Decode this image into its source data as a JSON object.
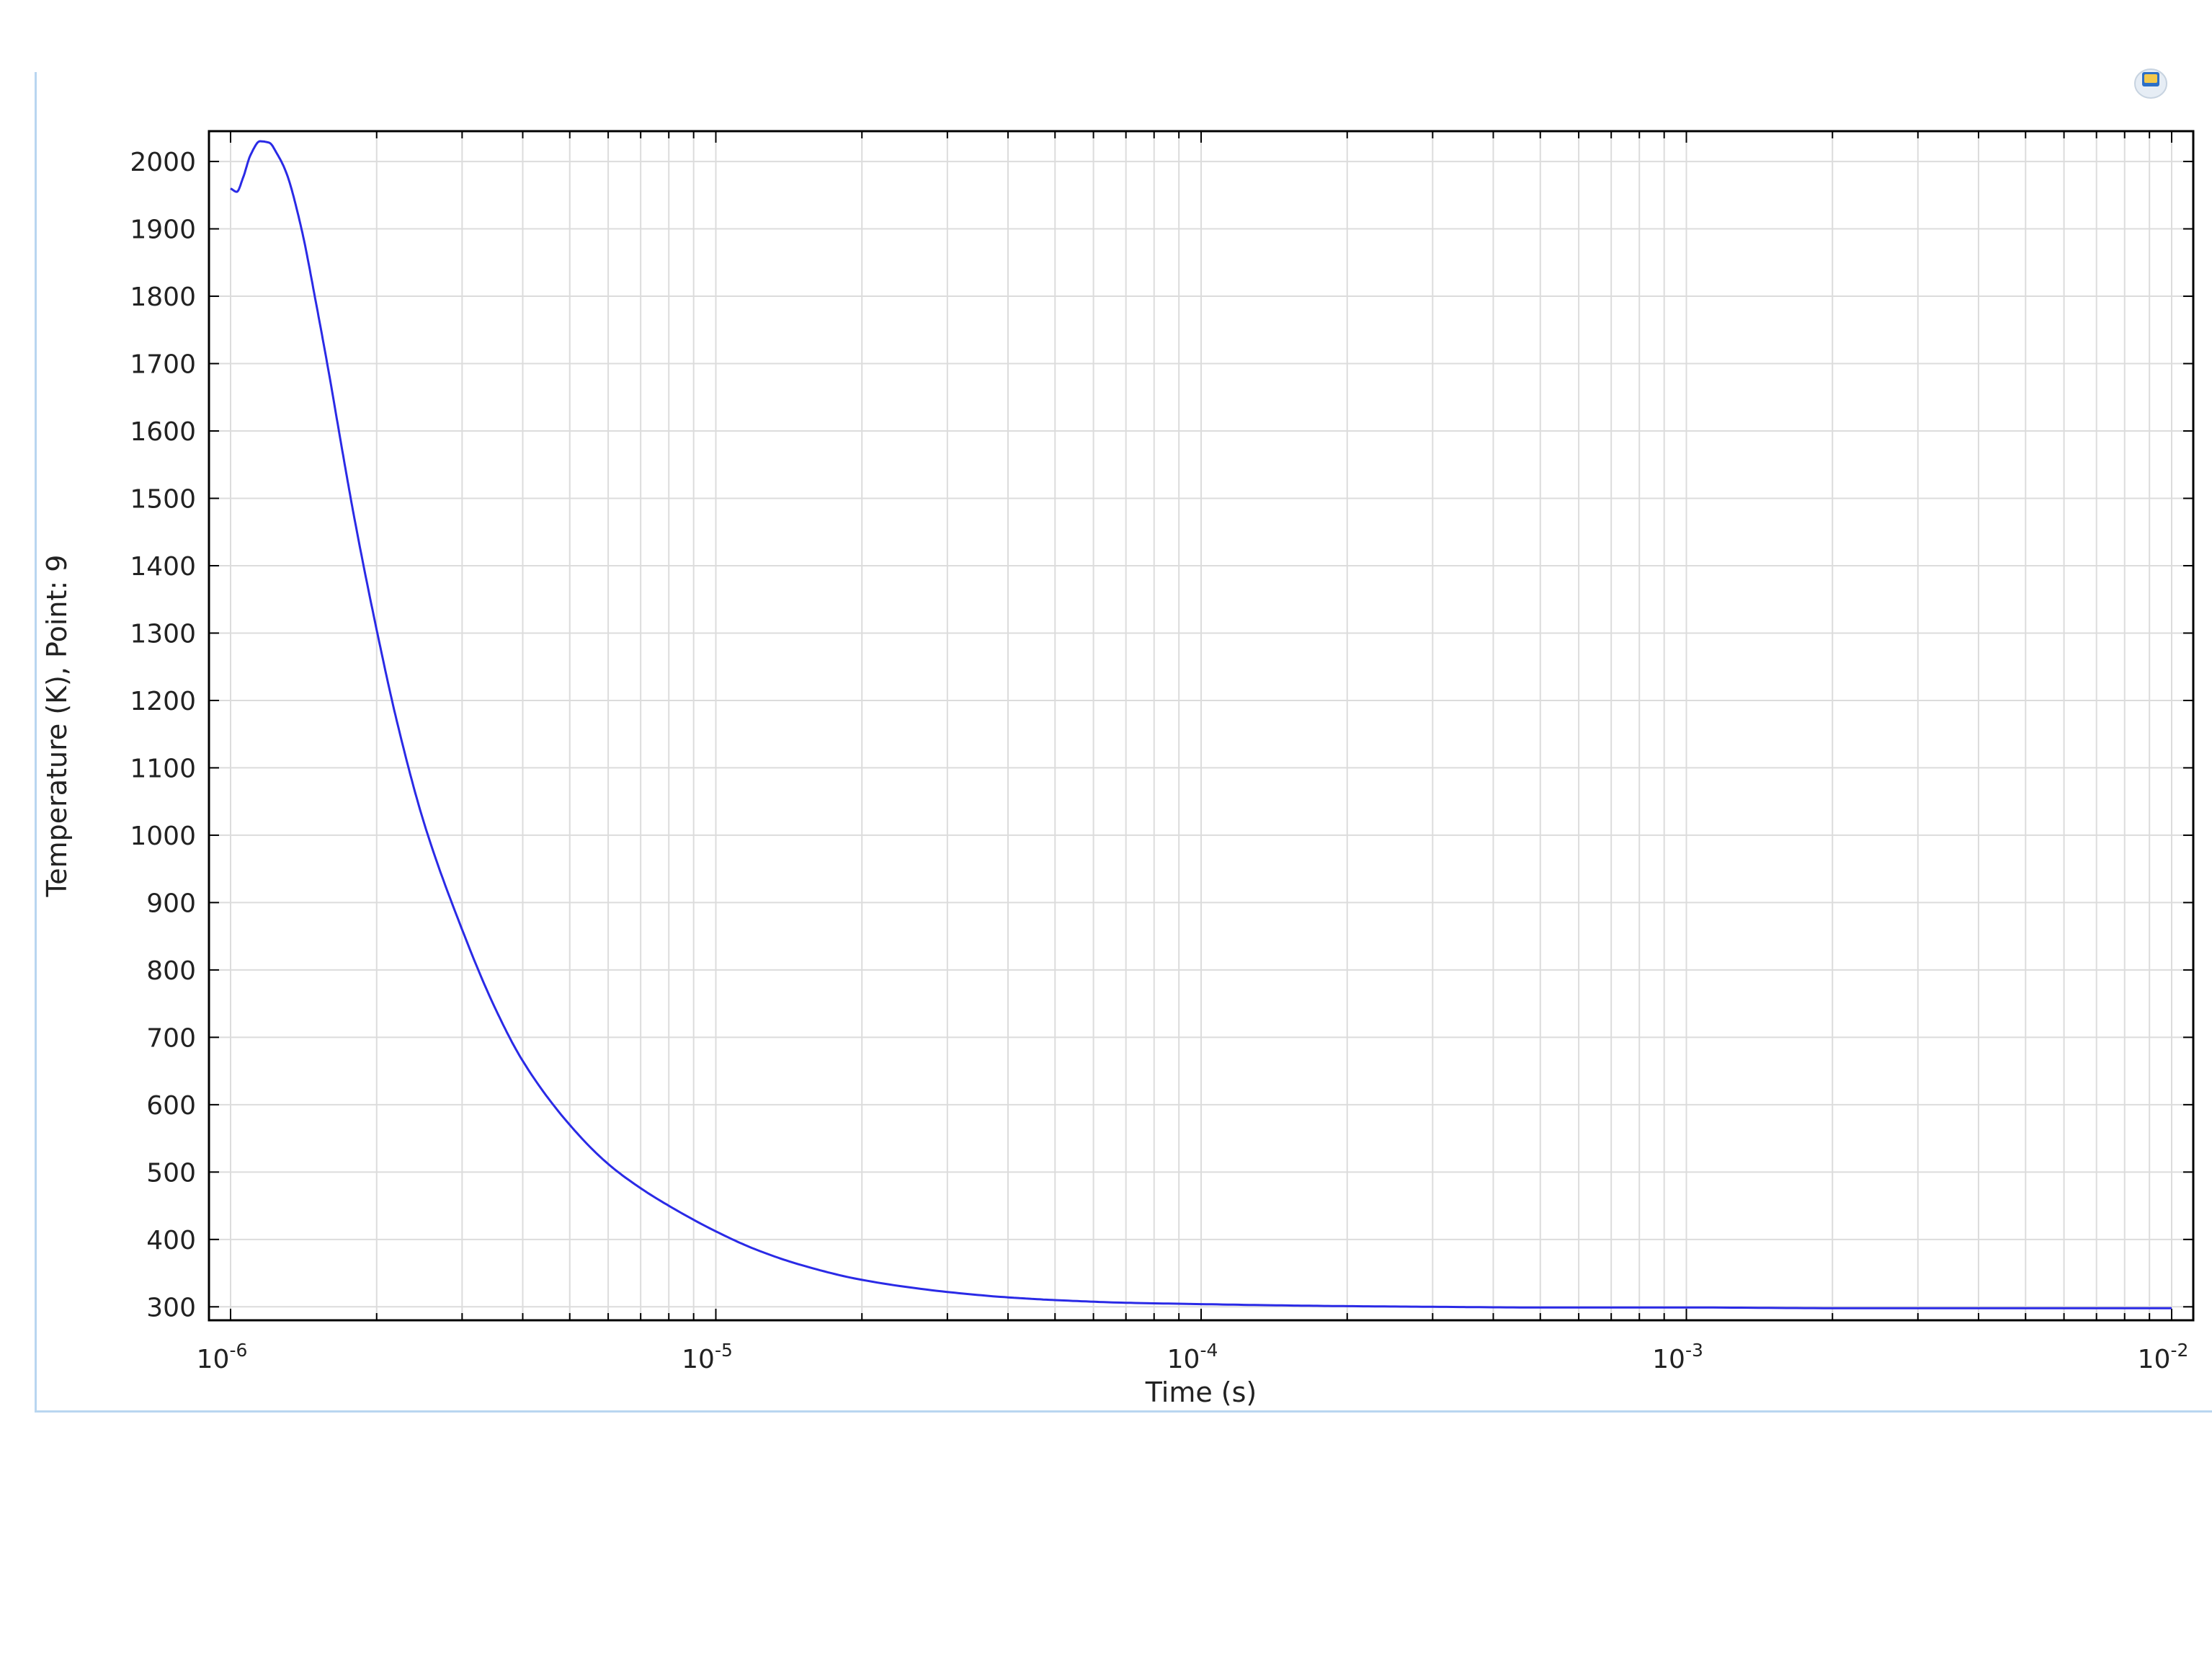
{
  "chart_data": {
    "type": "line",
    "title": "",
    "xlabel": "Time (s)",
    "ylabel": "Temperature (K), Point: 9",
    "x_scale": "log",
    "xlim": [
      1e-06,
      0.01
    ],
    "ylim": [
      280,
      2045
    ],
    "x_ticks": [
      1e-06,
      1e-05,
      0.0001,
      0.001,
      0.01
    ],
    "x_tick_labels": [
      {
        "base": "10",
        "exp": "-6"
      },
      {
        "base": "10",
        "exp": "-5"
      },
      {
        "base": "10",
        "exp": "-4"
      },
      {
        "base": "10",
        "exp": "-3"
      },
      {
        "base": "10",
        "exp": "-2"
      }
    ],
    "y_ticks": [
      300,
      400,
      500,
      600,
      700,
      800,
      900,
      1000,
      1100,
      1200,
      1300,
      1400,
      1500,
      1600,
      1700,
      1800,
      1900,
      2000
    ],
    "grid": true,
    "series": [
      {
        "color": "#2a2ae6",
        "x": [
          1e-06,
          1.03e-06,
          1.06e-06,
          1.1e-06,
          1.15e-06,
          1.2e-06,
          1.25e-06,
          1.3e-06,
          1.4e-06,
          1.5e-06,
          1.6e-06,
          1.7e-06,
          1.8e-06,
          2e-06,
          2.2e-06,
          2.5e-06,
          3e-06,
          3.5e-06,
          4e-06,
          5e-06,
          6e-06,
          7e-06,
          8e-06,
          1e-05,
          1.2e-05,
          1.5e-05,
          2e-05,
          3e-05,
          4e-05,
          5e-05,
          7e-05,
          0.0001,
          0.00015,
          0.0002,
          0.0003,
          0.0005,
          0.001,
          0.002,
          0.005,
          0.01
        ],
        "y": [
          1960,
          1955,
          1975,
          2010,
          2030,
          2028,
          2010,
          1985,
          1900,
          1790,
          1680,
          1570,
          1470,
          1305,
          1170,
          1020,
          860,
          745,
          665,
          570,
          512,
          476,
          450,
          412,
          386,
          362,
          340,
          322,
          314,
          310,
          306,
          304,
          302,
          301,
          300,
          299,
          299,
          298,
          298,
          298
        ]
      }
    ]
  },
  "colors": {
    "frame_border": "#b9d6f0",
    "grid": "#dcdcdc",
    "axes": "#000000",
    "line": "#2a2ae6"
  },
  "icons": {
    "corner": "window-badge-icon"
  }
}
